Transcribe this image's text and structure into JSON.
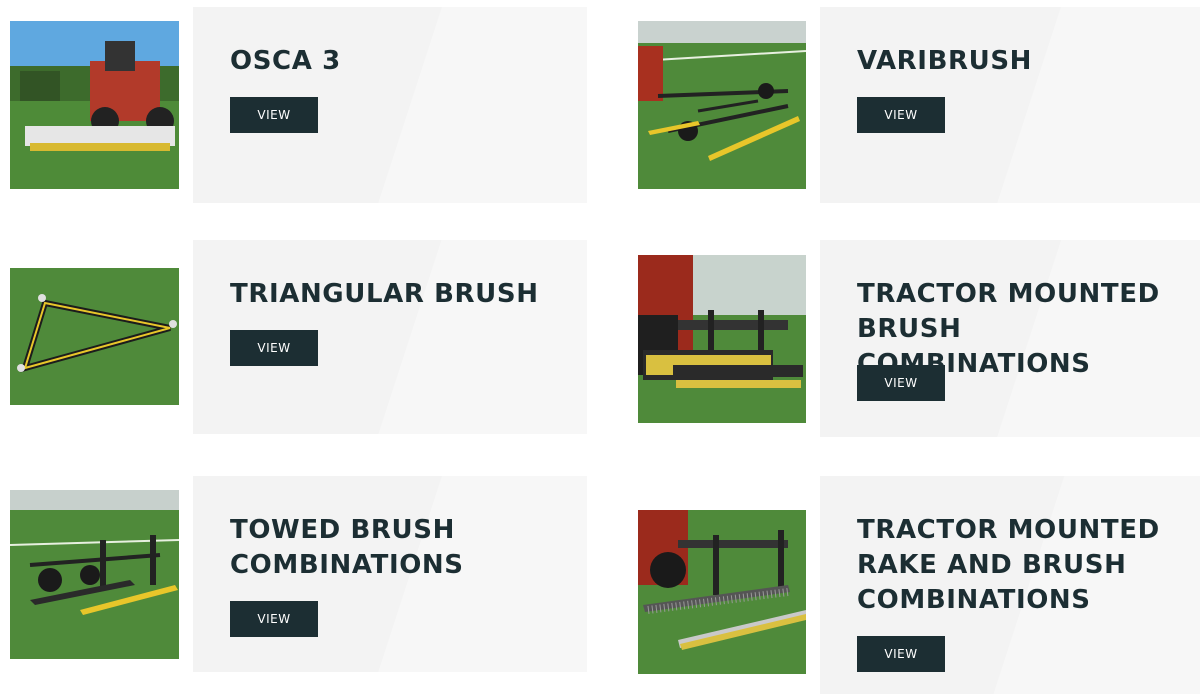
{
  "colors": {
    "title": "#1c2e33",
    "button_bg": "#1c2e33",
    "button_text": "#ffffff",
    "panel_bg": "#f3f3f3",
    "grass": "#4f8a3a",
    "brush_yellow": "#e8c62a"
  },
  "products": [
    {
      "title": "OSCA 3",
      "button_label": "VIEW",
      "image_icon": "tractor-brush-photo"
    },
    {
      "title": "VARIBRUSH",
      "button_label": "VIEW",
      "image_icon": "towed-brush-frame-photo"
    },
    {
      "title": "TRIANGULAR BRUSH",
      "button_label": "VIEW",
      "image_icon": "triangular-brush-photo"
    },
    {
      "title": "TRACTOR MOUNTED\nBRUSH COMBINATIONS",
      "button_label": "VIEW",
      "image_icon": "tractor-brush-combination-photo"
    },
    {
      "title": "TOWED BRUSH\nCOMBINATIONS",
      "button_label": "VIEW",
      "image_icon": "towed-brush-combination-photo"
    },
    {
      "title": "TRACTOR MOUNTED\nRAKE AND BRUSH\nCOMBINATIONS",
      "button_label": "VIEW",
      "image_icon": "tractor-rake-brush-photo"
    }
  ]
}
